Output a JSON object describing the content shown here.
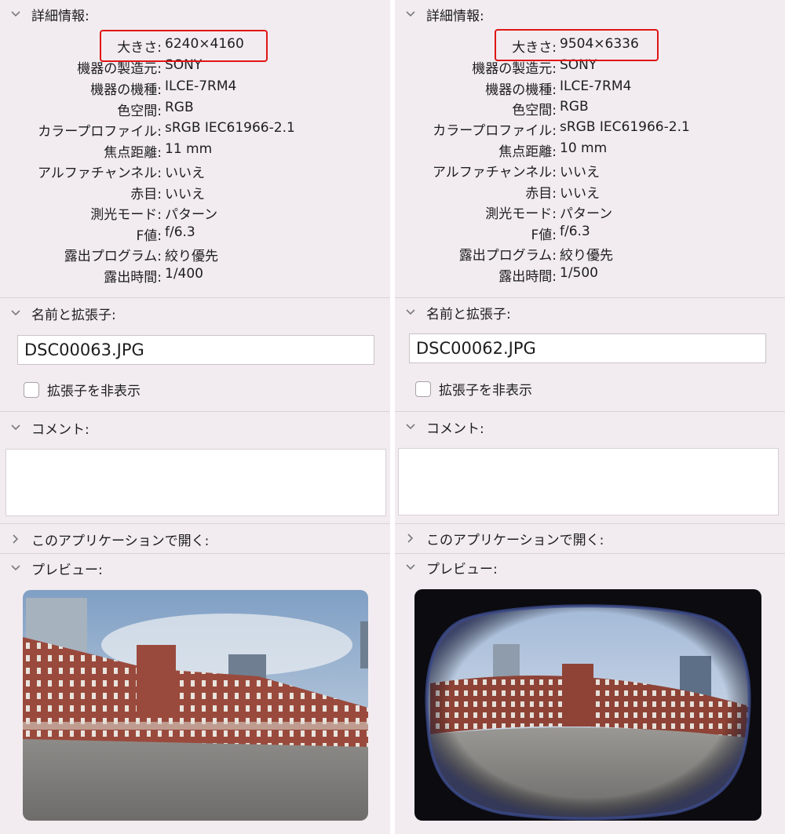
{
  "panels": [
    {
      "details_title": "詳細情報:",
      "rows": [
        {
          "k": "大きさ:",
          "v": "6240×4160"
        },
        {
          "k": "機器の製造元:",
          "v": "SONY"
        },
        {
          "k": "機器の機種:",
          "v": "ILCE-7RM4"
        },
        {
          "k": "色空間:",
          "v": "RGB"
        },
        {
          "k": "カラープロファイル:",
          "v": "sRGB IEC61966-2.1"
        },
        {
          "k": "焦点距離:",
          "v": "11 mm"
        },
        {
          "k": "アルファチャンネル:",
          "v": "いいえ"
        },
        {
          "k": "赤目:",
          "v": "いいえ"
        },
        {
          "k": "測光モード:",
          "v": "パターン"
        },
        {
          "k": "F値:",
          "v": "f/6.3"
        },
        {
          "k": "露出プログラム:",
          "v": "絞り優先"
        },
        {
          "k": "露出時間:",
          "v": "1/400"
        }
      ],
      "name_title": "名前と拡張子:",
      "filename": "DSC00063.JPG",
      "hide_ext_label": "拡張子を非表示",
      "comment_title": "コメント:",
      "open_with_title": "このアプリケーションで開く:",
      "preview_title": "プレビュー:"
    },
    {
      "details_title": "詳細情報:",
      "rows": [
        {
          "k": "大きさ:",
          "v": "9504×6336"
        },
        {
          "k": "機器の製造元:",
          "v": "SONY"
        },
        {
          "k": "機器の機種:",
          "v": "ILCE-7RM4"
        },
        {
          "k": "色空間:",
          "v": "RGB"
        },
        {
          "k": "カラープロファイル:",
          "v": "sRGB IEC61966-2.1"
        },
        {
          "k": "焦点距離:",
          "v": "10 mm"
        },
        {
          "k": "アルファチャンネル:",
          "v": "いいえ"
        },
        {
          "k": "赤目:",
          "v": "いいえ"
        },
        {
          "k": "測光モード:",
          "v": "パターン"
        },
        {
          "k": "F値:",
          "v": "f/6.3"
        },
        {
          "k": "露出プログラム:",
          "v": "絞り優先"
        },
        {
          "k": "露出時間:",
          "v": "1/500"
        }
      ],
      "name_title": "名前と拡張子:",
      "filename": "DSC00062.JPG",
      "hide_ext_label": "拡張子を非表示",
      "comment_title": "コメント:",
      "open_with_title": "このアプリケーションで開く:",
      "preview_title": "プレビュー:"
    }
  ],
  "colors": {
    "highlight": "#e01515",
    "panel_bg": "#f2ecf0",
    "facade": "#9a4a3c"
  },
  "icons": {
    "expanded": "chevron-down-icon",
    "collapsed": "chevron-right-icon"
  }
}
